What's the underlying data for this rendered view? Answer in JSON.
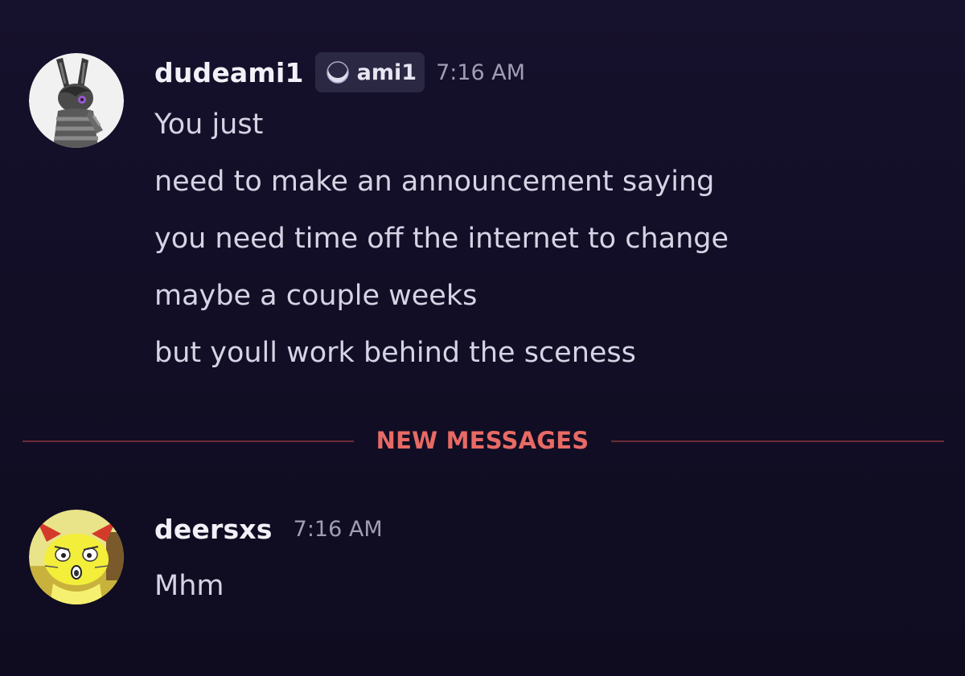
{
  "messages": [
    {
      "username": "dudeami1",
      "tag": {
        "icon": "moon-icon",
        "text": "ami1"
      },
      "timestamp": "7:16 AM",
      "lines": [
        "You just",
        "need to make an announcement saying",
        "you need time off the internet to change",
        "maybe a couple weeks",
        "but youll work behind the sceness"
      ]
    },
    {
      "username": "deersxs",
      "timestamp": "7:16 AM",
      "lines": [
        "Mhm"
      ]
    }
  ],
  "divider": {
    "label": "NEW MESSAGES"
  },
  "colors": {
    "background": "#140f2a",
    "username": "#f2f1f8",
    "message_text": "#d6d3e4",
    "timestamp": "#a09db4",
    "new_messages": "#e86a64",
    "tag_background": "#2b2843"
  }
}
